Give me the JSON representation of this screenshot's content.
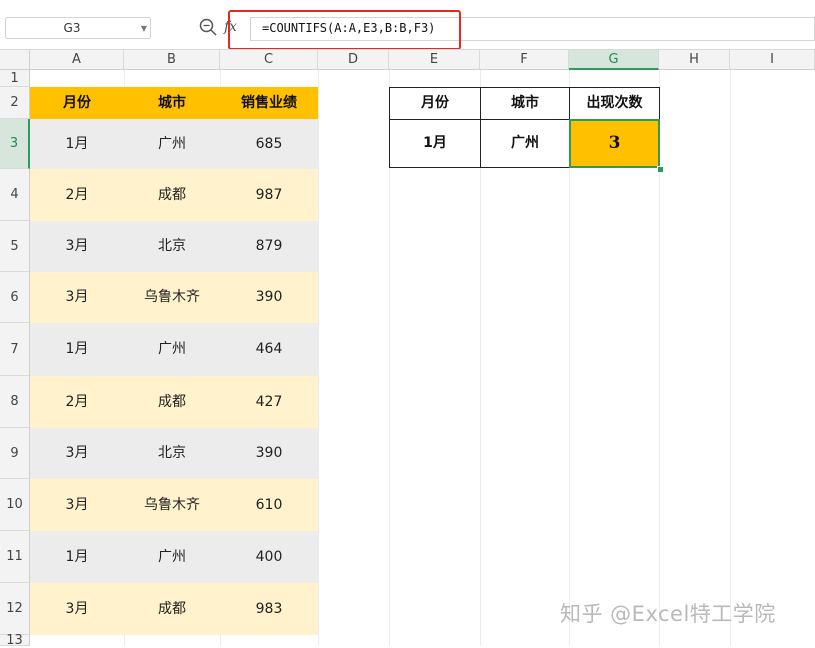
{
  "formula_bar": {
    "name_box": "G3",
    "formula": "=COUNTIFS(A:A,E3,B:B,F3)",
    "fx_label": "fx"
  },
  "columns": [
    "A",
    "B",
    "C",
    "D",
    "E",
    "F",
    "G",
    "H",
    "I"
  ],
  "rows": [
    "1",
    "2",
    "3",
    "4",
    "5",
    "6",
    "7",
    "8",
    "9",
    "10",
    "11",
    "12",
    "13"
  ],
  "data_table": {
    "headers": [
      "月份",
      "城市",
      "销售业绩"
    ],
    "rows": [
      {
        "month": "1月",
        "city": "广州",
        "sales": "685"
      },
      {
        "month": "2月",
        "city": "成都",
        "sales": "987"
      },
      {
        "month": "3月",
        "city": "北京",
        "sales": "879"
      },
      {
        "month": "3月",
        "city": "乌鲁木齐",
        "sales": "390"
      },
      {
        "month": "1月",
        "city": "广州",
        "sales": "464"
      },
      {
        "month": "2月",
        "city": "成都",
        "sales": "427"
      },
      {
        "month": "3月",
        "city": "北京",
        "sales": "390"
      },
      {
        "month": "3月",
        "city": "乌鲁木齐",
        "sales": "610"
      },
      {
        "month": "1月",
        "city": "广州",
        "sales": "400"
      },
      {
        "month": "3月",
        "city": "成都",
        "sales": "983"
      }
    ]
  },
  "lookup_table": {
    "headers": [
      "月份",
      "城市",
      "出现次数"
    ],
    "values": [
      "1月",
      "广州",
      "3"
    ]
  },
  "watermark": "知乎 @Excel特工学院",
  "colors": {
    "header_fill": "#ffc000",
    "row_gray": "#ececec",
    "row_yellow": "#fff2cc",
    "selection": "#2e9a5a",
    "highlight": "#e02b20"
  }
}
